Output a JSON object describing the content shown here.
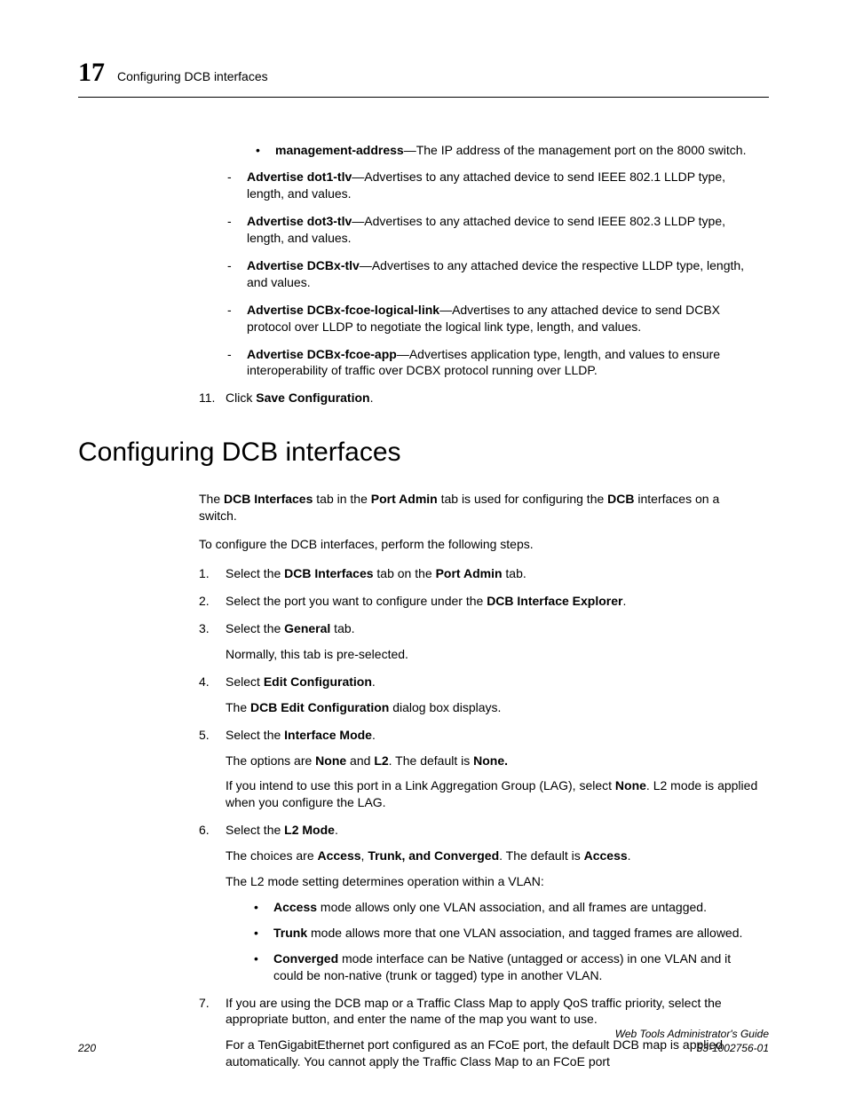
{
  "header": {
    "chapter_number": "17",
    "chapter_title": "Configuring DCB interfaces"
  },
  "top_section": {
    "sub_bullet": {
      "term": "management-address",
      "desc": "—The IP address of the management port on the 8000 switch."
    },
    "dash_items": [
      {
        "term": "Advertise dot1-tlv",
        "desc": "—Advertises to any attached device to send IEEE 802.1 LLDP type, length, and values."
      },
      {
        "term": "Advertise dot3-tlv",
        "desc": "—Advertises to any attached device to send IEEE 802.3 LLDP type, length, and values."
      },
      {
        "term": "Advertise DCBx-tlv",
        "desc": "—Advertises to any attached device the respective LLDP type, length, and values."
      },
      {
        "term": "Advertise DCBx-fcoe-logical-link",
        "desc": "—Advertises to any attached device to send DCBX protocol over LLDP to negotiate the logical link type, length, and values."
      },
      {
        "term": "Advertise DCBx-fcoe-app",
        "desc": "—Advertises application type, length, and values to ensure interoperability of traffic over DCBX protocol running over LLDP."
      }
    ],
    "step11": {
      "num": "11.",
      "pre": "Click ",
      "bold": "Save Configuration",
      "post": "."
    }
  },
  "section_heading": "Configuring DCB interfaces",
  "intro1": {
    "t1": "The ",
    "b1": "DCB Interfaces",
    "t2": " tab in the ",
    "b2": "Port Admin",
    "t3": " tab is used for configuring the ",
    "b3": "DCB",
    "t4": " interfaces on a switch."
  },
  "intro2": "To configure the DCB interfaces, perform the following steps.",
  "steps": {
    "s1": {
      "num": "1.",
      "t1": "Select the ",
      "b1": "DCB Interfaces",
      "t2": " tab on the ",
      "b2": "Port Admin",
      "t3": " tab."
    },
    "s2": {
      "num": "2.",
      "t1": "Select the port you want to configure under the ",
      "b1": "DCB Interface Explorer",
      "t2": "."
    },
    "s3": {
      "num": "3.",
      "t1": "Select the ",
      "b1": "General",
      "t2": " tab.",
      "sub": "Normally, this tab is pre-selected."
    },
    "s4": {
      "num": "4.",
      "t1": "Select ",
      "b1": "Edit Configuration",
      "t2": ".",
      "sub_t1": "The ",
      "sub_b1": "DCB Edit Configuration",
      "sub_t2": " dialog box displays."
    },
    "s5": {
      "num": "5.",
      "t1": "Select the ",
      "b1": "Interface Mode",
      "t2": ".",
      "p2_t1": "The options are ",
      "p2_b1": "None",
      "p2_t2": " and ",
      "p2_b2": "L2",
      "p2_t3": ". The default is ",
      "p2_b3": "None.",
      "p3_t1": "If you intend to use this port in a Link Aggregation Group (LAG), select ",
      "p3_b1": "None",
      "p3_t2": ". L2 mode is applied when you configure the LAG."
    },
    "s6": {
      "num": "6.",
      "t1": "Select the ",
      "b1": "L2 Mode",
      "t2": ".",
      "p2_t1": "The choices are ",
      "p2_b1": "Access",
      "p2_t2": ", ",
      "p2_b2": "Trunk, and Converged",
      "p2_t3": ". The default is ",
      "p2_b3": "Access",
      "p2_t4": ".",
      "p3": "The L2 mode setting determines operation within a VLAN:",
      "bullets": [
        {
          "b": "Access",
          "t": " mode allows only one VLAN association, and all frames are untagged."
        },
        {
          "b": "Trunk",
          "t": " mode allows more that one VLAN association, and tagged frames are allowed."
        },
        {
          "b": "Converged",
          "t": " mode interface can be Native (untagged or access) in one VLAN and it could be non-native (trunk or tagged) type in another VLAN."
        }
      ]
    },
    "s7": {
      "num": "7.",
      "p1": "If you are using the DCB map or a Traffic Class Map to apply QoS traffic priority, select the appropriate button, and enter the name of the map you want to use.",
      "p2": "For a TenGigabitEthernet port configured as an FCoE port, the default DCB map is applied automatically. You cannot apply the Traffic Class Map to an FCoE port"
    }
  },
  "footer": {
    "page": "220",
    "guide": "Web Tools Administrator's Guide",
    "docnum": "53-1002756-01"
  }
}
